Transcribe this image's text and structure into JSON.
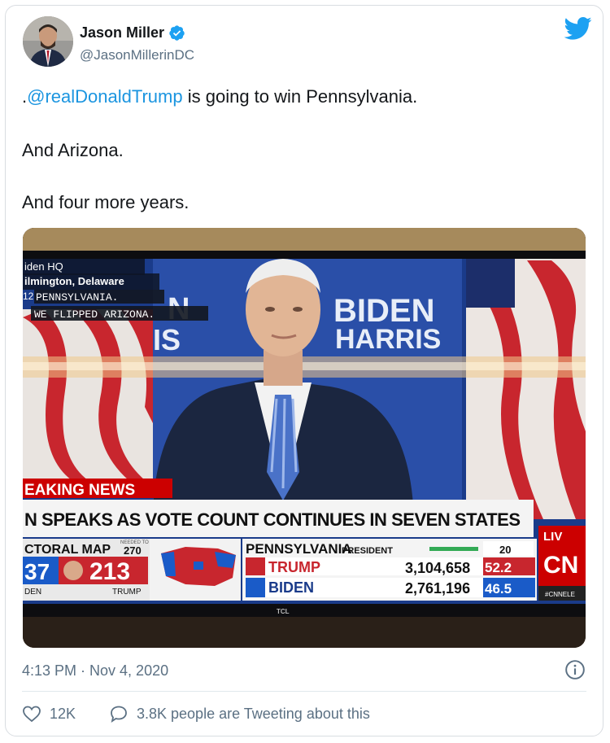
{
  "author": {
    "name": "Jason Miller",
    "handle": "@JasonMillerinDC"
  },
  "tweet": {
    "line1_mention": "@realDonaldTrump",
    "line1_prefix": ".",
    "line1_rest": " is going to win Pennsylvania.",
    "line2": "And Arizona.",
    "line3": "And four more years."
  },
  "media": {
    "tv_location_1": "iden HQ",
    "tv_location_2": "ilmington, Delaware",
    "tv_ticker_1": "PENNSYLVANIA.",
    "tv_ticker_num": "12",
    "tv_ticker_2": "WE FLIPPED ARIZONA.",
    "backdrop_1": "BIDEN",
    "backdrop_2": "HARRIS",
    "backdrop_left_1": "N",
    "backdrop_left_2": "IS",
    "breaking": "EAKING NEWS",
    "headline": "N SPEAKS AS VOTE COUNT CONTINUES IN SEVEN STATES",
    "map_label": "CTORAL MAP",
    "needed_label": "NEEDED TO WIN",
    "needed_value": "270",
    "biden_ev": "37",
    "trump_ev": "213",
    "biden_short": "DEN",
    "trump_short": "TRUMP",
    "state_label": "PENNSYLVANIA",
    "race_label": "PRESIDENT",
    "ev_votes": "20",
    "candidate_1": "TRUMP",
    "votes_1": "3,104,658",
    "pct_1": "52.2",
    "candidate_2": "BIDEN",
    "votes_2": "2,761,196",
    "pct_2": "46.5",
    "live": "LIV",
    "network": "CN",
    "hashtag": "#CNNELE",
    "tv_brand": "TCL"
  },
  "timestamp": "4:13 PM · Nov 4, 2020",
  "actions": {
    "likes": "12K",
    "tweeting": "3.8K people are Tweeting about this"
  },
  "colors": {
    "twitter_blue": "#1da1f2",
    "cnn_red": "#cc0000",
    "text_dark": "#14171a",
    "text_gray": "#5b7083"
  }
}
